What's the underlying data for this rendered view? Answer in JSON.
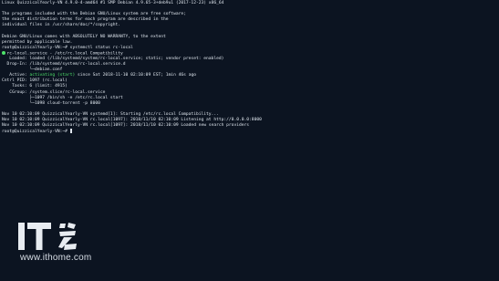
{
  "terminal": {
    "lines": {
      "l1": "Linux QuizzicalYearly-VN 4.9.0-4-amd64 #1 SMP Debian 4.9.65-3+deb9u1 (2017-12-23) x86_64",
      "l2": "",
      "l3": "The programs included with the Debian GNU/Linux system are free software;",
      "l4": "the exact distribution terms for each program are described in the",
      "l5": "individual files in /usr/share/doc/*/copyright.",
      "l6": "",
      "l7": "Debian GNU/Linux comes with ABSOLUTELY NO WARRANTY, to the extent",
      "l8": "permitted by applicable law.",
      "l9": "root@QuizzicalYearly-VN:~# systemctl status rc-local",
      "l10": "rc-local.service - /etc/rc.local Compatibility",
      "l11": "   Loaded: loaded (/lib/systemd/system/rc-local.service; static; vendor preset: enabled)",
      "l12": "  Drop-In: /lib/systemd/system/rc-local.service.d",
      "l13": "           └─debian.conf",
      "l14_label": "   Active: ",
      "l14_state": "activating (start)",
      "l14_rest": " since Sat 2018-11-10 02:10:09 EST; 1min 46s ago",
      "l15": "Cntrl PID: 1097 (rc.local)",
      "l16": "    Tasks: 6 (limit: 4915)",
      "l17": "   CGroup: /system.slice/rc-local.service",
      "l18": "           ├─1097 /bin/sh -e /etc/rc.local start",
      "l19": "           └─1098 cloud-torrent -p 8000",
      "l20": "",
      "l21": "Nov 10 02:10:09 QuizzicalYearly-VN systemd[1]: Starting /etc/rc.local Compatibility...",
      "l22": "Nov 10 02:10:09 QuizzicalYearly-VN rc.local[1097]: 2018/11/10 02:10:09 Listening at http://0.0.0.0:8000",
      "l23": "Nov 10 02:10:09 QuizzicalYearly-VN rc.local[1097]: 2018/11/10 02:10:09 Loaded new search providers",
      "l24": "root@QuizzicalYearly-VN:~# "
    }
  },
  "watermark": {
    "logo_text": "IT之家",
    "url": "www.ithome.com"
  },
  "colors": {
    "background": "#0c1421",
    "text": "#dfe6ee",
    "active_green": "#4ee36a"
  }
}
